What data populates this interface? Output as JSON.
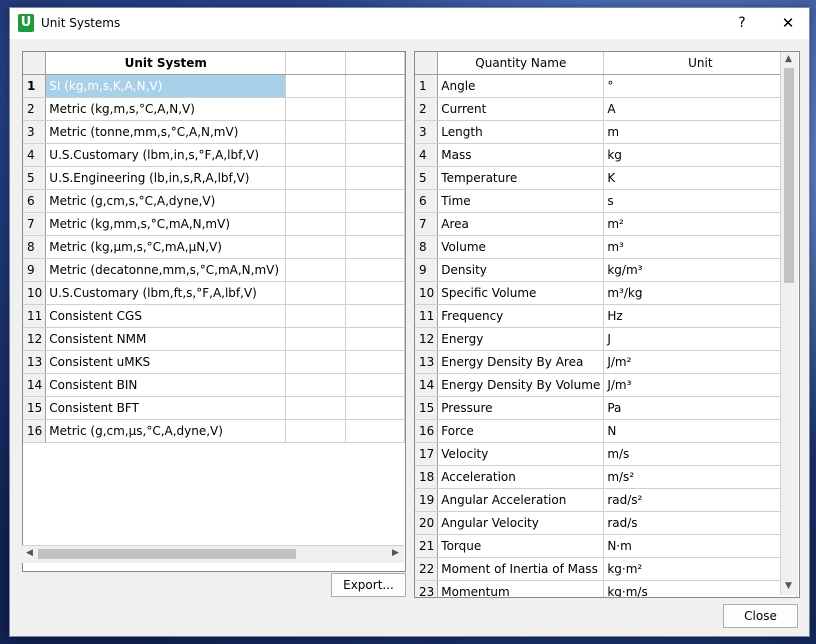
{
  "window": {
    "title": "Unit Systems",
    "help_label": "?",
    "close_label": "✕"
  },
  "left_grid": {
    "header": "Unit System",
    "rows": [
      {
        "num": "1",
        "text": "SI (kg,m,s,K,A,N,V)"
      },
      {
        "num": "2",
        "text": "Metric (kg,m,s,°C,A,N,V)"
      },
      {
        "num": "3",
        "text": "Metric (tonne,mm,s,°C,A,N,mV)"
      },
      {
        "num": "4",
        "text": "U.S.Customary (lbm,in,s,°F,A,lbf,V)"
      },
      {
        "num": "5",
        "text": "U.S.Engineering (lb,in,s,R,A,lbf,V)"
      },
      {
        "num": "6",
        "text": "Metric (g,cm,s,°C,A,dyne,V)"
      },
      {
        "num": "7",
        "text": "Metric (kg,mm,s,°C,mA,N,mV)"
      },
      {
        "num": "8",
        "text": "Metric (kg,μm,s,°C,mA,μN,V)"
      },
      {
        "num": "9",
        "text": "Metric (decatonne,mm,s,°C,mA,N,mV)"
      },
      {
        "num": "10",
        "text": "U.S.Customary (lbm,ft,s,°F,A,lbf,V)"
      },
      {
        "num": "11",
        "text": "Consistent CGS"
      },
      {
        "num": "12",
        "text": "Consistent NMM"
      },
      {
        "num": "13",
        "text": "Consistent uMKS"
      },
      {
        "num": "14",
        "text": "Consistent BIN"
      },
      {
        "num": "15",
        "text": "Consistent BFT"
      },
      {
        "num": "16",
        "text": "Metric (g,cm,μs,°C,A,dyne,V)"
      }
    ]
  },
  "right_grid": {
    "header_quantity": "Quantity Name",
    "header_unit": "Unit",
    "rows": [
      {
        "num": "1",
        "name": "Angle",
        "unit": "°"
      },
      {
        "num": "2",
        "name": "Current",
        "unit": "A"
      },
      {
        "num": "3",
        "name": "Length",
        "unit": "m"
      },
      {
        "num": "4",
        "name": "Mass",
        "unit": "kg"
      },
      {
        "num": "5",
        "name": "Temperature",
        "unit": "K"
      },
      {
        "num": "6",
        "name": "Time",
        "unit": "s"
      },
      {
        "num": "7",
        "name": "Area",
        "unit": "m²"
      },
      {
        "num": "8",
        "name": "Volume",
        "unit": "m³"
      },
      {
        "num": "9",
        "name": "Density",
        "unit": "kg/m³"
      },
      {
        "num": "10",
        "name": "Specific Volume",
        "unit": "m³/kg"
      },
      {
        "num": "11",
        "name": "Frequency",
        "unit": "Hz"
      },
      {
        "num": "12",
        "name": "Energy",
        "unit": "J"
      },
      {
        "num": "13",
        "name": "Energy Density By Area",
        "unit": "J/m²"
      },
      {
        "num": "14",
        "name": "Energy Density By Volume",
        "unit": "J/m³"
      },
      {
        "num": "15",
        "name": "Pressure",
        "unit": "Pa"
      },
      {
        "num": "16",
        "name": "Force",
        "unit": "N"
      },
      {
        "num": "17",
        "name": "Velocity",
        "unit": "m/s"
      },
      {
        "num": "18",
        "name": "Acceleration",
        "unit": "m/s²"
      },
      {
        "num": "19",
        "name": "Angular Acceleration",
        "unit": "rad/s²"
      },
      {
        "num": "20",
        "name": "Angular Velocity",
        "unit": "rad/s"
      },
      {
        "num": "21",
        "name": "Torque",
        "unit": "N·m"
      },
      {
        "num": "22",
        "name": "Moment of Inertia of Mass",
        "unit": "kg·m²"
      },
      {
        "num": "23",
        "name": "Momentum",
        "unit": "kg·m/s"
      }
    ]
  },
  "buttons": {
    "export_label": "Export...",
    "close_label": "Close"
  },
  "colors": {
    "selection": "#a9d0e9",
    "app_icon": "#1f9a3a"
  }
}
